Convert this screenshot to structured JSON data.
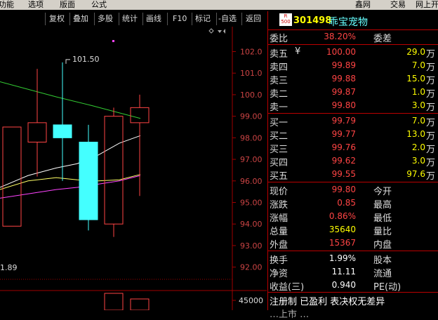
{
  "menu": [
    "功能",
    "选项",
    "版面",
    "公式",
    "鑫网",
    "交易",
    "网上开"
  ],
  "toolbar": {
    "buttons": [
      "复权",
      "叠加",
      "多股",
      "统计",
      "画线",
      "F10",
      "标记",
      "-自选",
      "返回"
    ]
  },
  "chart": {
    "y_ticks": [
      "102.0",
      "101.0",
      "100.0",
      "99.00",
      "98.00",
      "97.00",
      "96.00",
      "95.00",
      "94.00",
      "93.00",
      "92.00"
    ],
    "high_label": "101.50",
    "low_label": "1.89",
    "volume_tick": "45000",
    "colors": {
      "up": "#ff4444",
      "down": "#44ffff",
      "ma_white": "#ffffff",
      "ma_yellow": "#ffff66",
      "ma_magenta": "#ff44ff",
      "ma_green": "#33cc33",
      "grid": "#a00000"
    }
  },
  "chart_data": {
    "type": "candlestick",
    "ylim": [
      91.5,
      102.7
    ],
    "candles": [
      {
        "open": 93.9,
        "close": 98.5,
        "high": 98.5,
        "low": 93.9
      },
      {
        "open": 97.8,
        "close": 98.7,
        "high": 101.2,
        "low": 96.2
      },
      {
        "open": 98.6,
        "close": 98.0,
        "high": 101.5,
        "low": 96.0
      },
      {
        "open": 97.8,
        "close": 94.2,
        "high": 98.6,
        "low": 93.7
      },
      {
        "open": 94.0,
        "close": 99.0,
        "high": 99.4,
        "low": 93.4
      },
      {
        "open": 98.7,
        "close": 99.4,
        "high": 100.0,
        "low": 95.3
      }
    ],
    "ma_lines": [
      {
        "color": "#33cc33",
        "points": [
          [
            0,
            100.6
          ],
          [
            40,
            100.25
          ],
          [
            80,
            99.9
          ],
          [
            130,
            99.5
          ],
          [
            200,
            98.9
          ]
        ]
      },
      {
        "color": "#ffffff",
        "points": [
          [
            0,
            95.7
          ],
          [
            40,
            96.25
          ],
          [
            80,
            96.6
          ],
          [
            110,
            96.8
          ],
          [
            140,
            97.2
          ],
          [
            170,
            97.75
          ],
          [
            200,
            98.1
          ]
        ]
      },
      {
        "color": "#ffff66",
        "points": [
          [
            0,
            95.6
          ],
          [
            40,
            96.0
          ],
          [
            80,
            96.15
          ],
          [
            110,
            96.05
          ],
          [
            140,
            96.0
          ],
          [
            170,
            96.05
          ],
          [
            200,
            96.3
          ]
        ]
      },
      {
        "color": "#ff44ff",
        "points": [
          [
            0,
            95.2
          ],
          [
            40,
            95.4
          ],
          [
            80,
            95.6
          ],
          [
            110,
            95.7
          ],
          [
            140,
            95.85
          ],
          [
            170,
            96.0
          ],
          [
            200,
            96.25
          ]
        ]
      }
    ]
  },
  "stock": {
    "badge": "R\n500",
    "code": "301498",
    "name": "乖宝宠物"
  },
  "weibi": {
    "label": "委比",
    "value": "38.20%",
    "label2": "委差"
  },
  "sell": [
    {
      "label": "卖五",
      "mark": "¥",
      "price": "100.00",
      "vol": "29.0",
      "unit": "万"
    },
    {
      "label": "卖四",
      "mark": "",
      "price": "99.89",
      "vol": "7.0",
      "unit": "万"
    },
    {
      "label": "卖三",
      "mark": "",
      "price": "99.88",
      "vol": "15.0",
      "unit": "万"
    },
    {
      "label": "卖二",
      "mark": "",
      "price": "99.87",
      "vol": "1.0",
      "unit": "万"
    },
    {
      "label": "卖一",
      "mark": "",
      "price": "99.80",
      "vol": "3.0",
      "unit": "万"
    }
  ],
  "buy": [
    {
      "label": "买一",
      "price": "99.79",
      "vol": "7.0",
      "unit": "万"
    },
    {
      "label": "买二",
      "price": "99.77",
      "vol": "13.0",
      "unit": "万"
    },
    {
      "label": "买三",
      "price": "99.76",
      "vol": "2.0",
      "unit": "万"
    },
    {
      "label": "买四",
      "price": "99.62",
      "vol": "3.0",
      "unit": "万"
    },
    {
      "label": "买五",
      "price": "99.55",
      "vol": "97.6",
      "unit": "万"
    }
  ],
  "quote": [
    {
      "l1": "现价",
      "v1": "99.80",
      "c1": "red",
      "l2": "今开"
    },
    {
      "l1": "涨跌",
      "v1": "0.85",
      "c1": "red",
      "l2": "最高"
    },
    {
      "l1": "涨幅",
      "v1": "0.86%",
      "c1": "red",
      "l2": "最低"
    },
    {
      "l1": "总量",
      "v1": "35640",
      "c1": "yel",
      "l2": "量比"
    },
    {
      "l1": "外盘",
      "v1": "15367",
      "c1": "red",
      "l2": "内盘"
    }
  ],
  "extra": [
    {
      "l1": "换手",
      "v1": "1.99%",
      "l2": "股本"
    },
    {
      "l1": "净资",
      "v1": "11.11",
      "l2": "流通"
    },
    {
      "l1": "收益(三)",
      "v1": "0.940",
      "l2": "PE(动)"
    }
  ],
  "footer": "注册制 已盈利 表决权无差异",
  "footer2": "…上市 …"
}
